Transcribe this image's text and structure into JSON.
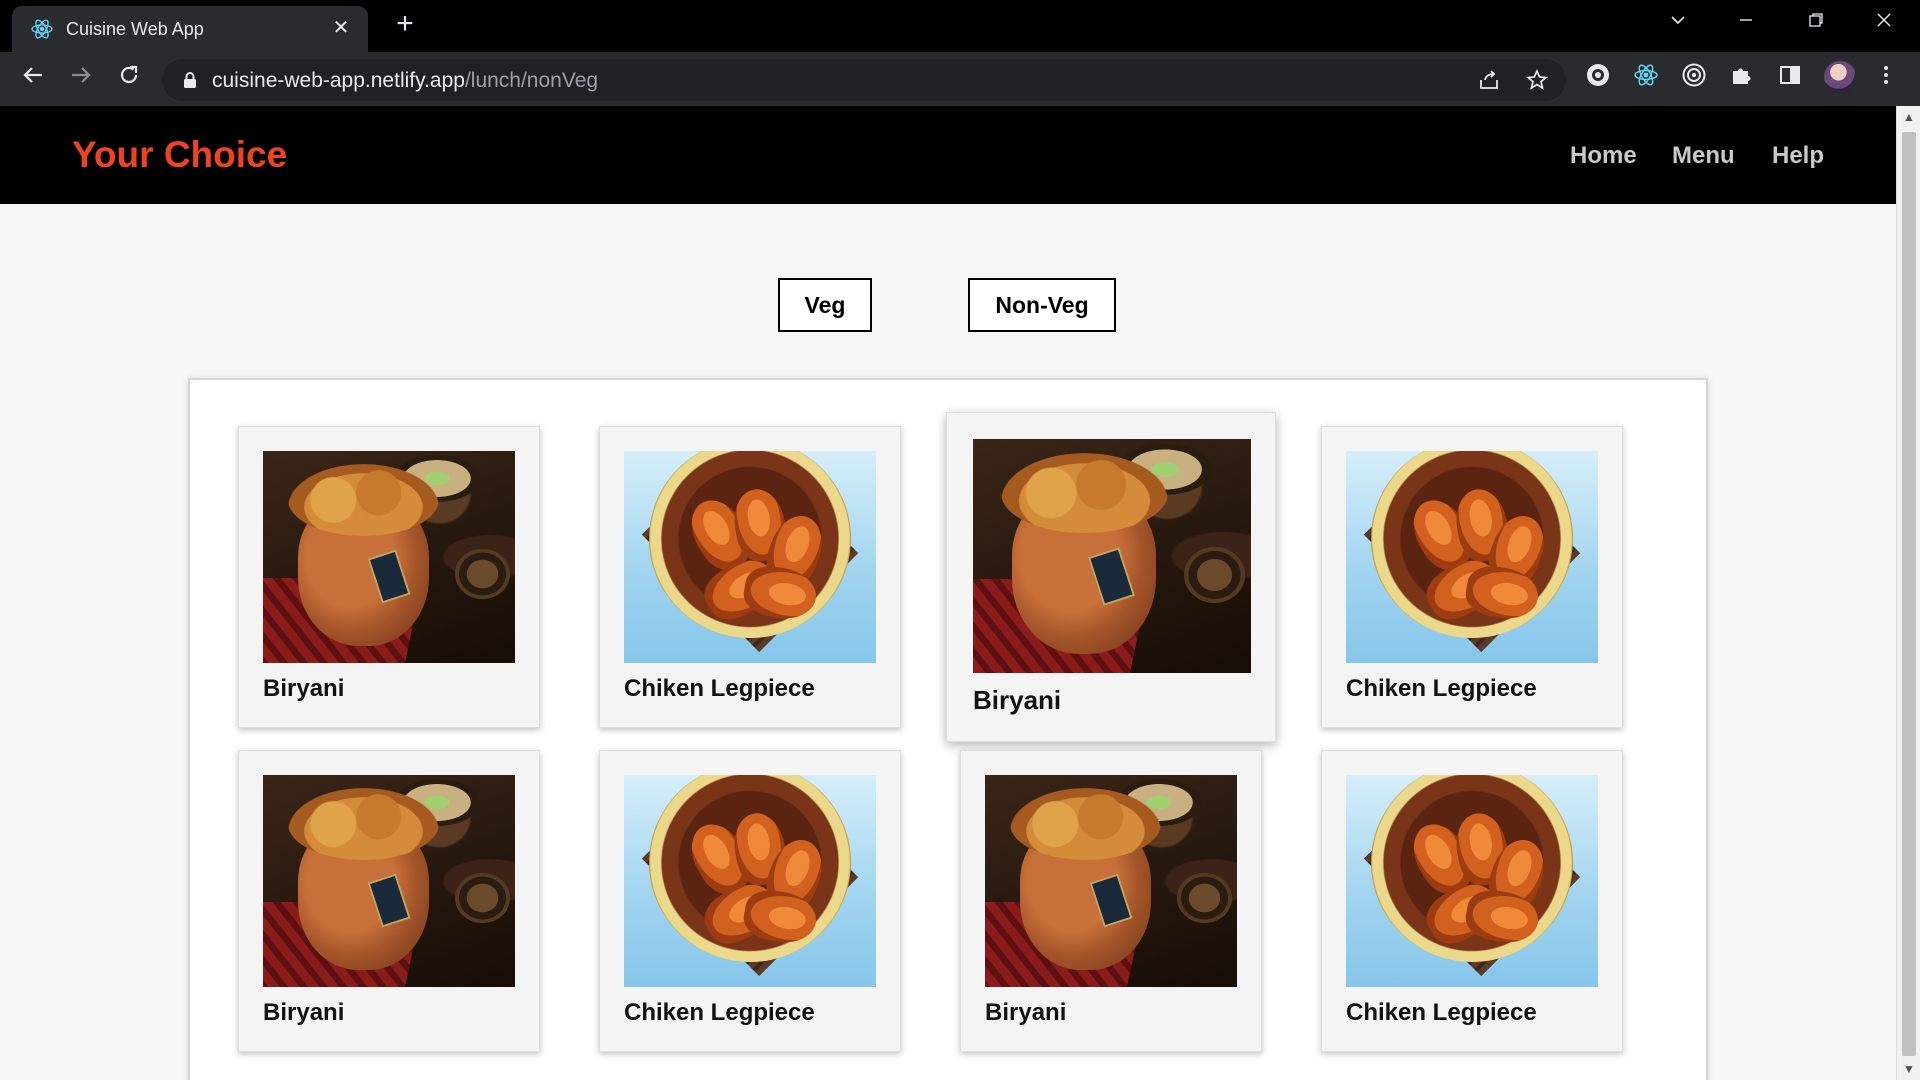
{
  "browser": {
    "tab_title": "Cuisine Web App",
    "url_host": "cuisine-web-app.netlify.app",
    "url_path": "/lunch/nonVeg",
    "tab_close_glyph": "✕",
    "new_tab_glyph": "+",
    "icons": {
      "tab_favicon": "react-icon",
      "back": "back-arrow-icon",
      "forward": "forward-arrow-icon",
      "reload": "reload-icon",
      "lock": "lock-icon",
      "share": "share-icon",
      "bookmark": "star-icon",
      "extensions": [
        "extension-icon",
        "react-devtools-icon",
        "target-icon",
        "puzzle-icon",
        "sidepanel-icon"
      ],
      "avatar": "profile-avatar",
      "menu": "kebab-menu-icon"
    }
  },
  "site": {
    "brand": "Your Choice",
    "brand_color": "#f0421e",
    "nav": [
      "Home",
      "Menu",
      "Help"
    ]
  },
  "filters": {
    "veg_label": "Veg",
    "nonveg_label": "Non-Veg"
  },
  "items": [
    {
      "title": "Biryani",
      "image": "biryani"
    },
    {
      "title": "Chiken Legpiece",
      "image": "chicken"
    },
    {
      "title": "Biryani",
      "image": "biryani",
      "hovered": true
    },
    {
      "title": "Chiken Legpiece",
      "image": "chicken"
    },
    {
      "title": "Biryani",
      "image": "biryani"
    },
    {
      "title": "Chiken Legpiece",
      "image": "chicken"
    },
    {
      "title": "Biryani",
      "image": "biryani"
    },
    {
      "title": "Chiken Legpiece",
      "image": "chicken"
    }
  ]
}
